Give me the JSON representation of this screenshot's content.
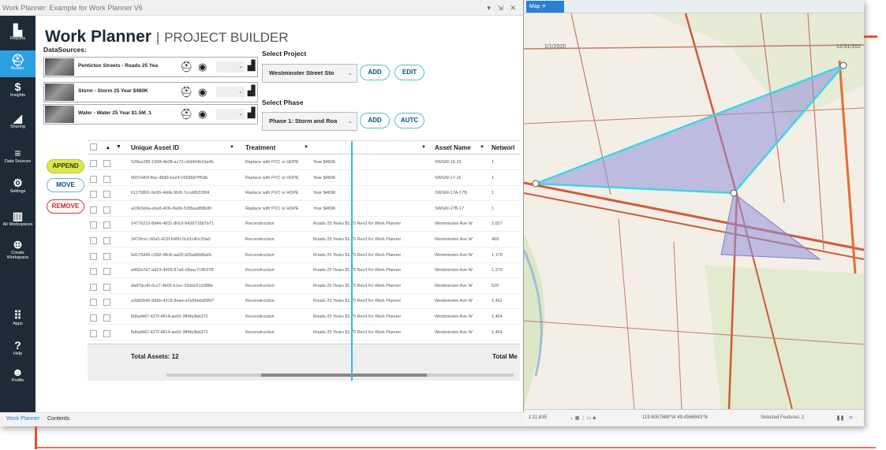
{
  "window_title": "Work Planner: Example for Work Planner V6",
  "window_controls": "▾ ⇲ ✕",
  "rail": [
    {
      "label": "Reports",
      "icon": "report-icon",
      "glyph": "▙"
    },
    {
      "label": "Builder",
      "icon": "builder-icon",
      "glyph": "⛑"
    },
    {
      "label": "Insights",
      "icon": "insights-icon",
      "glyph": "$"
    },
    {
      "label": "Sharing",
      "icon": "sharing-icon",
      "glyph": "◢"
    },
    {
      "label": "Data Sources",
      "icon": "data-sources-icon",
      "glyph": "≡"
    },
    {
      "label": "Settings",
      "icon": "settings-icon",
      "glyph": "⚙"
    },
    {
      "label": "All Workspaces",
      "icon": "workspaces-icon",
      "glyph": "▥"
    },
    {
      "label": "Create Workspace",
      "icon": "create-workspace-icon",
      "glyph": "⊕"
    },
    {
      "label": "Apps",
      "icon": "apps-icon",
      "glyph": "⠿"
    },
    {
      "label": "Help",
      "icon": "help-icon",
      "glyph": "?"
    },
    {
      "label": "Profile",
      "icon": "profile-icon",
      "glyph": "☻"
    }
  ],
  "header": {
    "title": "Work Planner",
    "separator": "|",
    "subtitle": "PROJECT BUILDER"
  },
  "datasources": {
    "label": "DataSources:",
    "items": [
      {
        "name": "Penticton Streets - Roads 25 Yea"
      },
      {
        "name": "Storm - Storm 25 Year $480K"
      },
      {
        "name": "Water - Water 25 Year $1.5M_1"
      }
    ]
  },
  "select_project": {
    "label": "Select Project",
    "value": "Westminster Street Sto",
    "add": "ADD",
    "edit": "EDIT"
  },
  "select_phase": {
    "label": "Select Phase",
    "value": "Phase 1: Storm and Roa",
    "add": "ADD",
    "auto": "AUTC"
  },
  "actions": {
    "append": "APPEND",
    "move": "MOVE",
    "remove": "REMOVE"
  },
  "table": {
    "headers": [
      "Unique Asset ID",
      "Treatment",
      "Asset Name",
      "Networl"
    ],
    "rows": [
      {
        "id": "526be288-1998-4b08-ac72-c0d404b1ba4b",
        "treatment": "Replace with PVC or HDPE",
        "desc": "Year $480K",
        "name": "SWGM-16-15",
        "net": "1"
      },
      {
        "id": "0507e85f-ffac-48d0-ba24-0368b87ff5db",
        "treatment": "Replace with PVC or HDPE",
        "desc": "Year $480K",
        "name": "SWGM-17-16",
        "net": "1"
      },
      {
        "id": "61170801-9e95-4ddb-9fc8-7cca9fb335f4",
        "treatment": "Replace with PVC or HDPE",
        "desc": "Year $480K",
        "name": "SWGM-17A-17B",
        "net": "1"
      },
      {
        "id": "a1063eba-eba8-40fe-8a0b-53f8aad58bd0",
        "treatment": "Replace with PVC or HDPE",
        "desc": "Year $480K",
        "name": "SWGM-17B-17",
        "net": "1"
      },
      {
        "id": "14776210-8d46-4831-80c9-9436733b7b71",
        "treatment": "Reconstruction",
        "desc": "Roads 25 Years $1.75 Rev3 for Work Planner",
        "name": "Westminster Ave W",
        "net": "2,027"
      },
      {
        "id": "3473fcec-90a0-422f-b450-0cd1c40c20a0",
        "treatment": "Reconstruction",
        "desc": "Roads 25 Years $1.75 Rev3 for Work Planner",
        "name": "Westminster Ave W",
        "net": "469"
      },
      {
        "id": "5d175d90-c558-48c8-aa28-d25ad6bfba0c",
        "treatment": "Reconstruction",
        "desc": "Roads 25 Years $1.75 Rev3 for Work Planner",
        "name": "Westminster Ave W",
        "net": "1,170"
      },
      {
        "id": "a492e7b7-a923-4459-87a6-c8aac7c9637B",
        "treatment": "Reconstruction",
        "desc": "Roads 25 Years $1.75 Rev3 for Work Planner",
        "name": "Westminster Ave W",
        "net": "1,370"
      },
      {
        "id": "dad7bcd6-6cc7-4b05-b1ec-25d0e512088e",
        "treatment": "Reconstruction",
        "desc": "Roads 25 Years $1.75 Rev3 for Work Planner",
        "name": "Westminster Ave W",
        "net": "620"
      },
      {
        "id": "e2b82b40-9d9b-4319-8eae-e2e56ebd5897",
        "treatment": "Reconstruction",
        "desc": "Roads 25 Years $1.75 Rev3 for Work Planner",
        "name": "Westminster Ave W",
        "net": "1,462"
      },
      {
        "id": "fb8ad487-427f-4814-aeb5-3ff4fa3bb372",
        "treatment": "Reconstruction",
        "desc": "Roads 25 Years $1.75 Rev3 for Work Planner",
        "name": "Westminster Ave W",
        "net": "1,464"
      },
      {
        "id": "fb8ad487-427f-4814-aeb5-3ff4fa3bb372",
        "treatment": "Reconstruction",
        "desc": "Roads 25 Years $1.75 Rev3 for Work Planner",
        "name": "Westminster Ave W",
        "net": "1,464"
      }
    ],
    "total_assets": "Total Assets: 12",
    "total_me": "Total Me"
  },
  "bottom_tabs": {
    "work_planner": "Work Planner",
    "contents": "Contents"
  },
  "map": {
    "tab": "Map",
    "date_start": "1/1/2020",
    "date_end": "12/31/202",
    "scale": "1:11,835",
    "coords": "119.6057888°W 49.4566943°N",
    "selected": "Selected Features: 2"
  },
  "colors": {
    "accent": "#2b9fe0",
    "rail": "#1e2a36",
    "polygon": "#8f8fd8",
    "polygon_edge": "#3cd6e6",
    "road": "#d05a3a"
  }
}
